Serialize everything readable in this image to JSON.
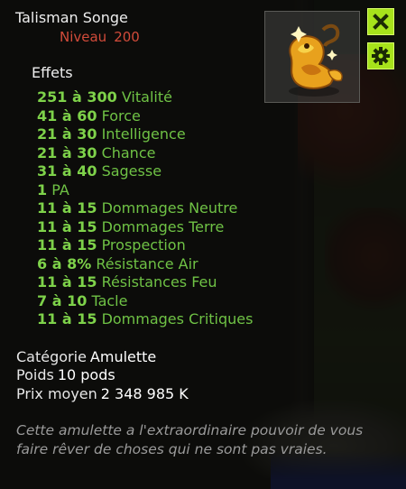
{
  "item": {
    "name": "Talisman Songe",
    "level_label": "Niveau",
    "level_value": "200",
    "icon": "golden-lizard-amulet-icon"
  },
  "controls": {
    "close_icon": "close-icon",
    "settings_icon": "gear-icon",
    "accent_color": "#a6e21b"
  },
  "effects": {
    "title": "Effets",
    "items": [
      {
        "value": "251 à 300",
        "label": "Vitalité"
      },
      {
        "value": "41 à 60",
        "label": "Force"
      },
      {
        "value": "21 à 30",
        "label": "Intelligence"
      },
      {
        "value": "21 à 30",
        "label": "Chance"
      },
      {
        "value": "31 à 40",
        "label": "Sagesse"
      },
      {
        "value": "1",
        "label": "PA"
      },
      {
        "value": "11 à 15",
        "label": "Dommages Neutre"
      },
      {
        "value": "11 à 15",
        "label": "Dommages Terre"
      },
      {
        "value": "11 à 15",
        "label": "Prospection"
      },
      {
        "value": "6 à 8%",
        "label": "Résistance Air"
      },
      {
        "value": "11 à 15",
        "label": "Résistances Feu"
      },
      {
        "value": "7 à 10",
        "label": "Tacle"
      },
      {
        "value": "11 à 15",
        "label": "Dommages Critiques"
      }
    ]
  },
  "info": {
    "category_label": "Catégorie",
    "category_value": "Amulette",
    "weight_label": "Poids",
    "weight_value": "10 pods",
    "price_label": "Prix moyen",
    "price_value": "2 348 985 K"
  },
  "description": "Cette amulette a l'extraordinaire pouvoir de vous faire rêver de choses qui ne sont pas vraies."
}
